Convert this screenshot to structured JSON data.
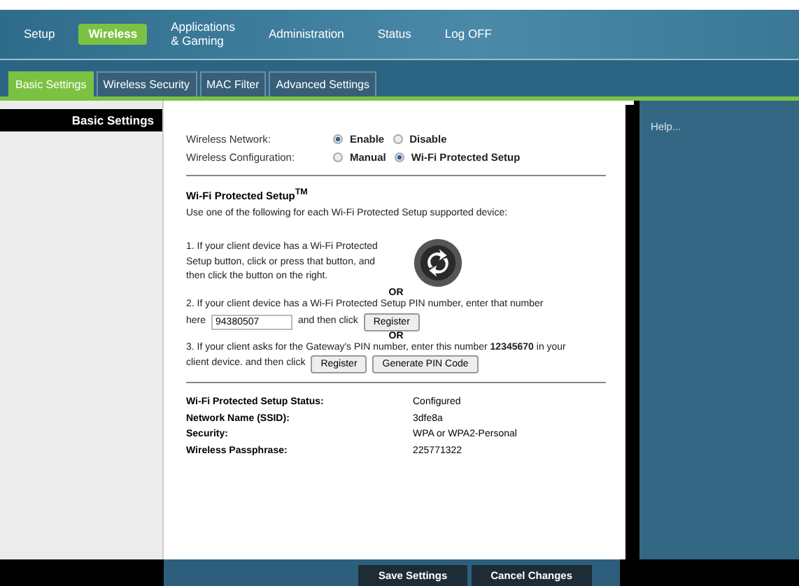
{
  "nav": [
    {
      "label": "Setup",
      "selected": false
    },
    {
      "label": "Wireless",
      "selected": true
    },
    {
      "label": "Applications\n& Gaming",
      "selected": false
    },
    {
      "label": "Administration",
      "selected": false
    },
    {
      "label": "Status",
      "selected": false
    },
    {
      "label": "Log OFF",
      "selected": false
    }
  ],
  "tabs": [
    {
      "label": "Basic Settings",
      "selected": true
    },
    {
      "label": "Wireless Security",
      "selected": false
    },
    {
      "label": "MAC Filter",
      "selected": false
    },
    {
      "label": "Advanced Settings",
      "selected": false
    }
  ],
  "sidebar": {
    "title": "Basic Settings"
  },
  "settings": [
    {
      "label": "Wireless Network:",
      "options": [
        {
          "label": "Enable",
          "selected": true
        },
        {
          "label": "Disable",
          "selected": false
        }
      ]
    },
    {
      "label": "Wireless Configuration:",
      "options": [
        {
          "label": "Manual",
          "selected": false
        },
        {
          "label": "Wi-Fi Protected Setup",
          "selected": true
        }
      ]
    }
  ],
  "wps": {
    "title": "Wi-Fi Protected Setup$^{TM}$",
    "intro": "Use one of the following for each Wi-Fi Protected Setup supported device:",
    "step1": "1. If your client device has a Wi-Fi Protected Setup button, click or press that button, and then click the button on the right.",
    "or_1": "OR",
    "step2": "2. If your client device has a Wi-Fi Protected Setup PIN number, enter that number",
    "step2_here": "here",
    "pin": "94380507",
    "step2_then": "and then click",
    "register_1": "Register",
    "or_2": "OR",
    "step3": "3. If your client asks for the Gateway's PIN number, enter this number **12345670** in your",
    "step3_b": "client device. and then click",
    "register_2": "Register",
    "generate": "Generate PIN Code"
  },
  "status": [
    {
      "label": "Wi-Fi Protected Setup Status:",
      "value": "Configured"
    },
    {
      "label": "Network Name (SSID):",
      "value": "3dfe8a"
    },
    {
      "label": "Security:",
      "value": "WPA or WPA2-Personal"
    },
    {
      "label": "Wireless Passphrase:",
      "value": "225771322"
    }
  ],
  "help": {
    "label": "Help..."
  },
  "footer": {
    "save": "Save Settings",
    "cancel": "Cancel Changes"
  }
}
